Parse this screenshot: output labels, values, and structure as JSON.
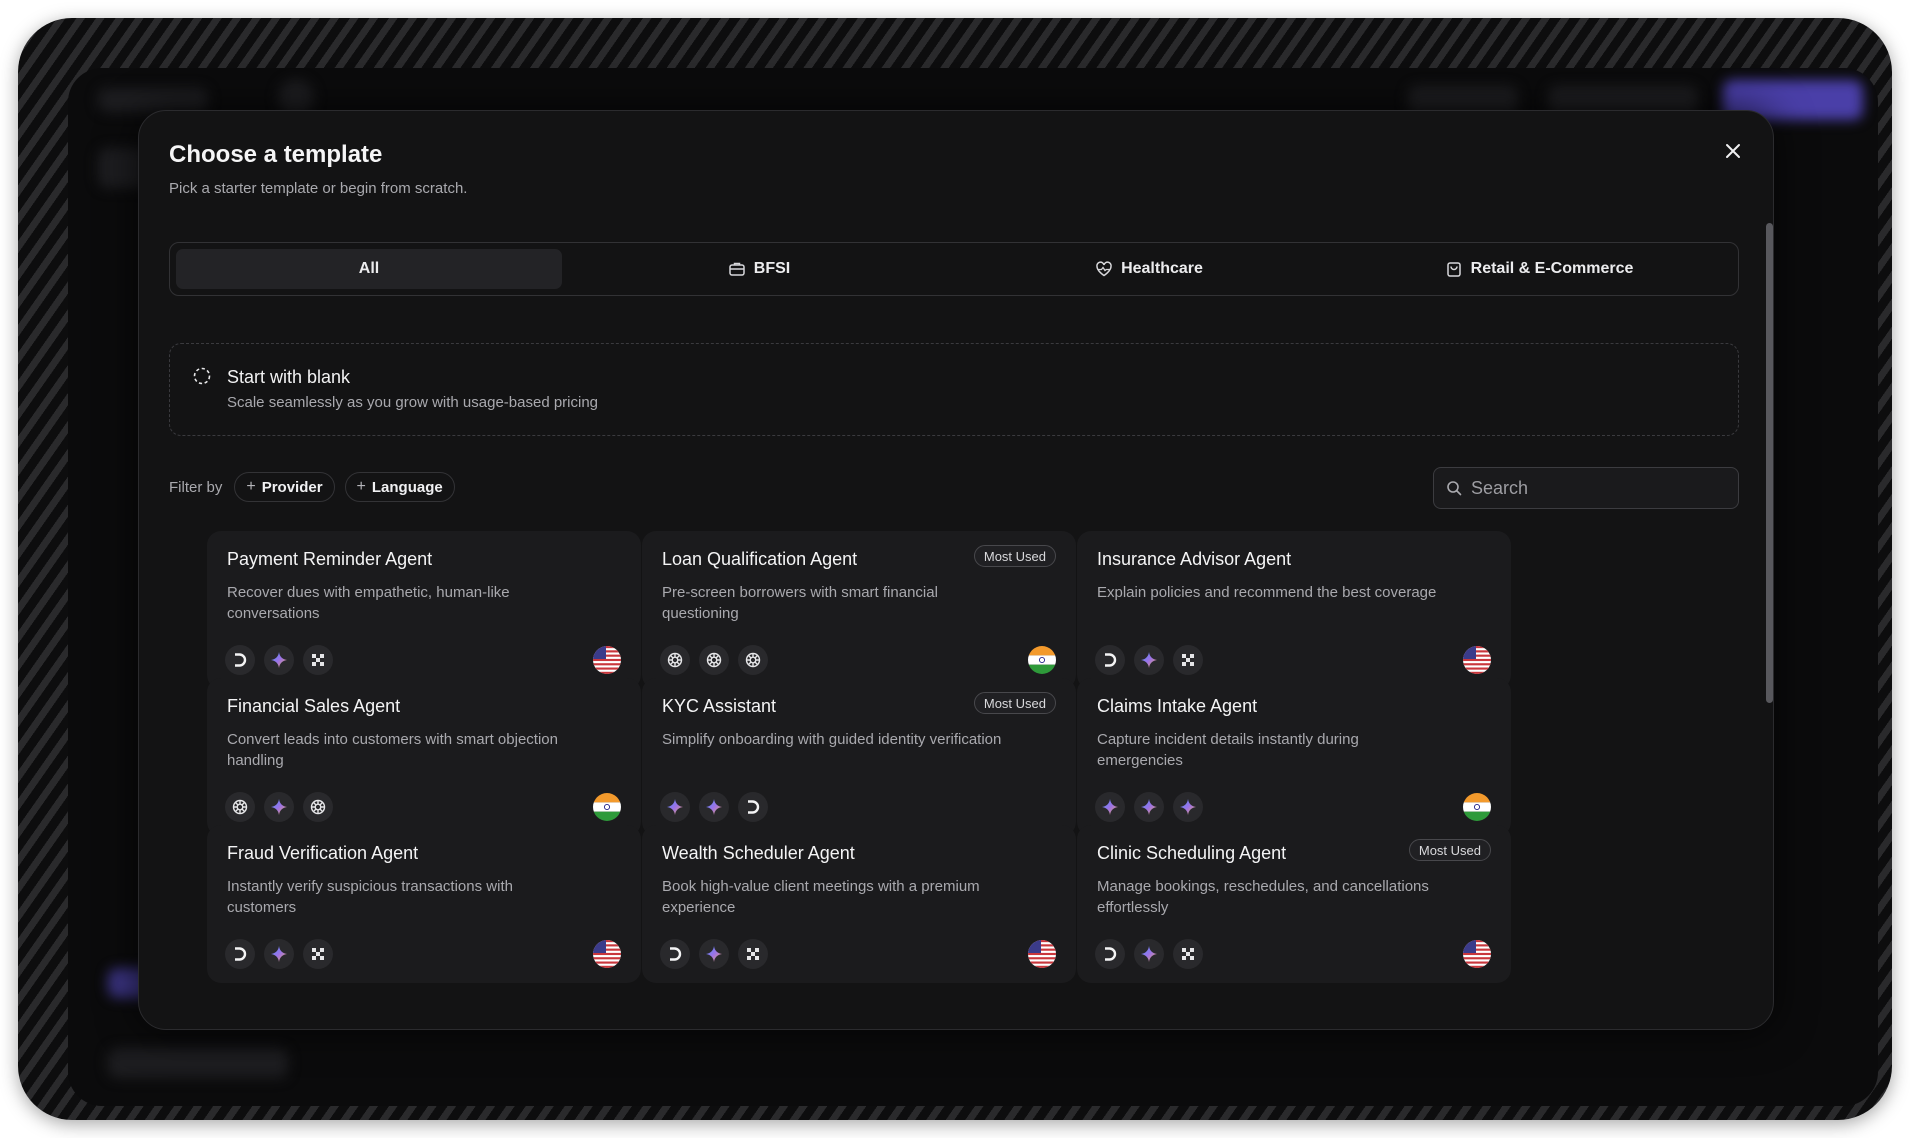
{
  "modal": {
    "title": "Choose a template",
    "subtitle": "Pick a starter template or begin from scratch."
  },
  "tabs": [
    {
      "label": "All",
      "icon": "none",
      "active": true
    },
    {
      "label": "BFSI",
      "icon": "briefcase-icon",
      "active": false
    },
    {
      "label": "Healthcare",
      "icon": "heart-pulse-icon",
      "active": false
    },
    {
      "label": "Retail & E-Commerce",
      "icon": "shopping-bag-icon",
      "active": false
    }
  ],
  "blank": {
    "title": "Start with blank",
    "description": "Scale seamlessly as you grow with usage-based pricing"
  },
  "filters": {
    "label": "Filter by",
    "provider": "Provider",
    "language": "Language"
  },
  "search": {
    "placeholder": "Search"
  },
  "badge_text": "Most Used",
  "cards": [
    {
      "title": "Payment Reminder Agent",
      "description": "Recover dues with empathetic, human-like conversations",
      "most_used": false,
      "providers": [
        "deepgram-icon",
        "gemini-icon",
        "elevenlabs-icon"
      ],
      "flag": "us"
    },
    {
      "title": "Loan Qualification Agent",
      "description": "Pre-screen borrowers with smart financial questioning",
      "most_used": true,
      "providers": [
        "openai-icon",
        "openai-icon",
        "openai-icon"
      ],
      "flag": "in"
    },
    {
      "title": "Insurance Advisor Agent",
      "description": "Explain policies and recommend the best coverage",
      "most_used": false,
      "providers": [
        "deepgram-icon",
        "gemini-icon",
        "elevenlabs-icon"
      ],
      "flag": "us"
    },
    {
      "title": "Financial Sales Agent",
      "description": "Convert leads into customers with smart objection handling",
      "most_used": false,
      "providers": [
        "openai-icon",
        "gemini-icon",
        "openai-icon"
      ],
      "flag": "in"
    },
    {
      "title": "KYC Assistant",
      "description": "Simplify onboarding with guided identity verification",
      "most_used": true,
      "providers": [
        "gemini-icon",
        "gemini-icon",
        "deepgram-icon"
      ],
      "flag": "none"
    },
    {
      "title": "Claims Intake Agent",
      "description": "Capture incident details instantly during emergencies",
      "most_used": false,
      "providers": [
        "gemini-icon",
        "gemini-icon",
        "gemini-icon"
      ],
      "flag": "in"
    },
    {
      "title": "Fraud Verification Agent",
      "description": "Instantly verify suspicious transactions with customers",
      "most_used": false,
      "providers": [
        "deepgram-icon",
        "gemini-icon",
        "elevenlabs-icon"
      ],
      "flag": "us"
    },
    {
      "title": "Wealth Scheduler Agent",
      "description": "Book high-value client meetings with a premium experience",
      "most_used": false,
      "providers": [
        "deepgram-icon",
        "gemini-icon",
        "elevenlabs-icon"
      ],
      "flag": "us"
    },
    {
      "title": "Clinic Scheduling Agent",
      "description": "Manage bookings, reschedules, and cancellations effortlessly",
      "most_used": true,
      "providers": [
        "deepgram-icon",
        "gemini-icon",
        "elevenlabs-icon"
      ],
      "flag": "us"
    }
  ]
}
